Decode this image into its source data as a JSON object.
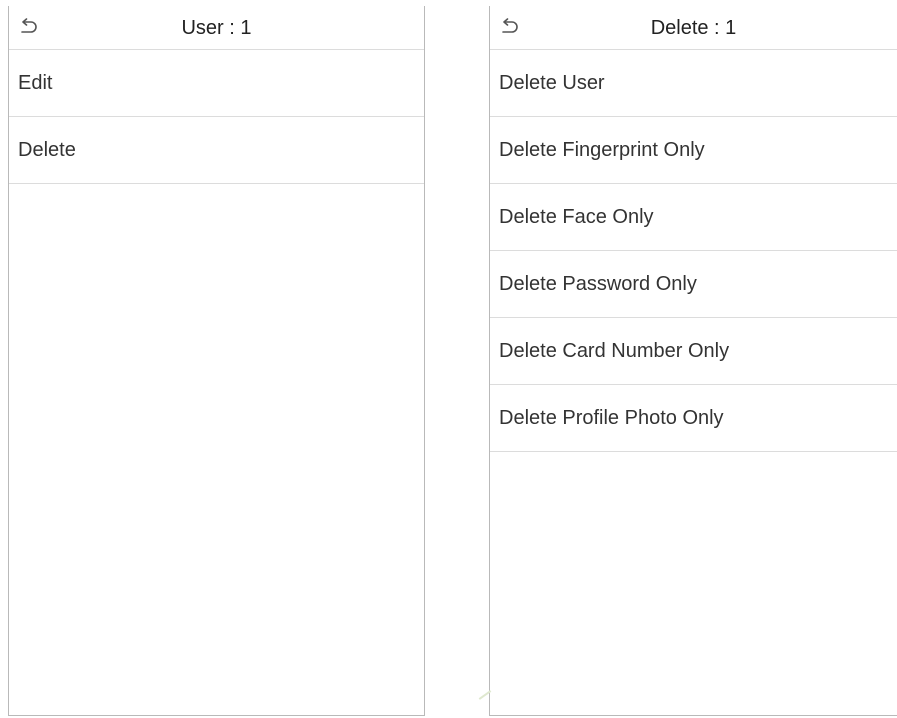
{
  "left_screen": {
    "header": {
      "back_icon": "return-arrow-icon",
      "title": "User : 1"
    },
    "menu": [
      {
        "label": "Edit"
      },
      {
        "label": "Delete"
      }
    ]
  },
  "right_screen": {
    "header": {
      "back_icon": "return-arrow-icon",
      "title": "Delete : 1"
    },
    "menu": [
      {
        "label": "Delete User"
      },
      {
        "label": "Delete Fingerprint Only"
      },
      {
        "label": "Delete Face Only"
      },
      {
        "label": "Delete Password Only"
      },
      {
        "label": "Delete Card Number Only"
      },
      {
        "label": "Delete Profile Photo Only"
      }
    ]
  },
  "colors": {
    "divider": "#dcdcdc",
    "frame_border": "#b9b9b9",
    "text": "#333333"
  }
}
